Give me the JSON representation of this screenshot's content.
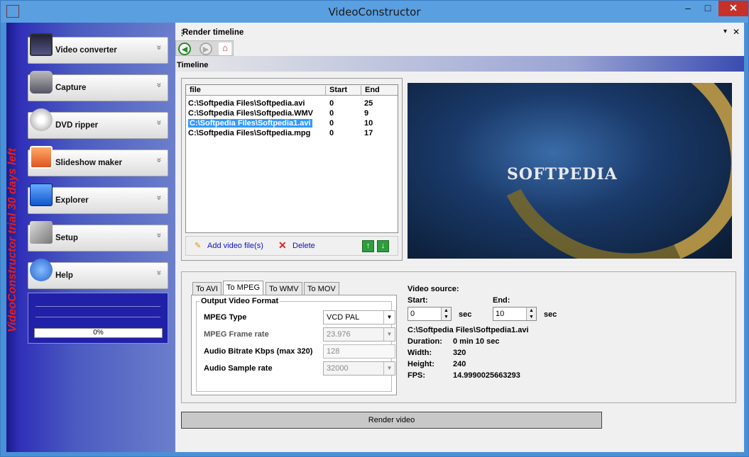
{
  "window": {
    "title": "VideoConstructor",
    "minimize_glyph": "–",
    "maximize_glyph": "□",
    "close_glyph": "✕"
  },
  "sidebar": {
    "trial_text": "VideoConstructor trial 30 days left",
    "items": [
      {
        "label": "Video converter",
        "icon": "film-icon"
      },
      {
        "label": "Capture",
        "icon": "camera-icon"
      },
      {
        "label": "DVD ripper",
        "icon": "dvd-icon"
      },
      {
        "label": "Slideshow maker",
        "icon": "slideshow-icon"
      },
      {
        "label": "Explorer",
        "icon": "checkbox-icon"
      },
      {
        "label": "Setup",
        "icon": "tools-icon"
      },
      {
        "label": "Help",
        "icon": "info-icon"
      }
    ],
    "chevron_glyph": "»",
    "progress": {
      "percent": 0,
      "label": "0%"
    }
  },
  "panel": {
    "title": "Render timeline",
    "pin_glyph": "▾",
    "close_glyph": "✕"
  },
  "toolbar": {
    "back_glyph": "◀",
    "forward_glyph": "▶",
    "home_glyph": "⌂"
  },
  "timeline": {
    "section_title": "Timeline",
    "columns": [
      "file",
      "Start",
      "End"
    ],
    "rows": [
      {
        "file": "C:\\Softpedia Files\\Softpedia.avi",
        "start": "0",
        "end": "25",
        "selected": false
      },
      {
        "file": "C:\\Softpedia Files\\Softpedia.WMV",
        "start": "0",
        "end": "9",
        "selected": false
      },
      {
        "file": "C:\\Softpedia Files\\Softpedia1.avi",
        "start": "0",
        "end": "10",
        "selected": true
      },
      {
        "file": "C:\\Softpedia Files\\Softpedia.mpg",
        "start": "0",
        "end": "17",
        "selected": false
      }
    ],
    "add_label": "Add video file(s)",
    "delete_label": "Delete",
    "up_glyph": "↑",
    "down_glyph": "↓"
  },
  "preview": {
    "logo_text": "SOFTPEDIA"
  },
  "format_tabs": [
    "To AVI",
    "To MPEG",
    "To WMV",
    "To MOV"
  ],
  "active_tab": "To MPEG",
  "output": {
    "group_label": "Output Video Format",
    "mpeg_type_label": "MPEG Type",
    "mpeg_type_value": "VCD PAL",
    "frame_rate_label": "MPEG Frame rate",
    "frame_rate_value": "23.976",
    "audio_bitrate_label": "Audio Bitrate Kbps (max 320)",
    "audio_bitrate_value": "128",
    "sample_rate_label": "Audio Sample rate",
    "sample_rate_value": "32000",
    "dropdown_glyph": "▼"
  },
  "video_source": {
    "heading": "Video source:",
    "start_label": "Start:",
    "start_value": "0",
    "end_label": "End:",
    "end_value": "10",
    "unit": "sec",
    "file": "C:\\Softpedia Files\\Softpedia1.avi",
    "duration_label": "Duration:",
    "duration_value": "0 min 10 sec",
    "width_label": "Width:",
    "width_value": "320",
    "height_label": "Height:",
    "height_value": "240",
    "fps_label": "FPS:",
    "fps_value": "14.9990025663293",
    "spin_up": "▲",
    "spin_down": "▼"
  },
  "render_label": "Render video"
}
